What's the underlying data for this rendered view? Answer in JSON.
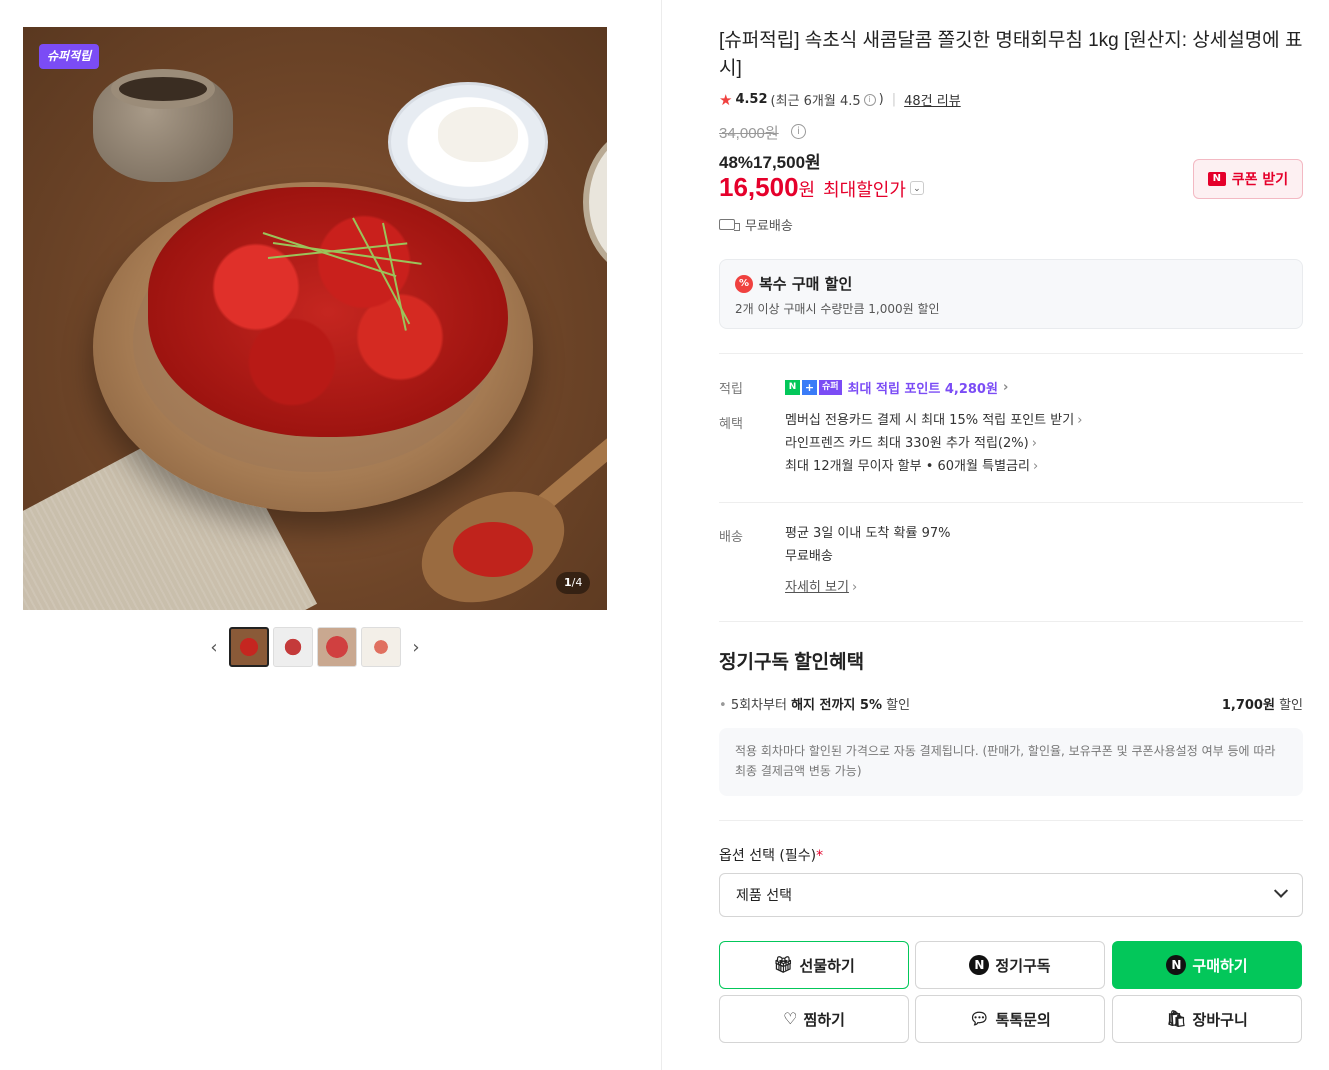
{
  "gallery": {
    "badge": "슈퍼적립",
    "counter_current": "1",
    "counter_total": "/4",
    "prev_icon": "chevron-left-icon",
    "next_icon": "chevron-right-icon"
  },
  "product": {
    "title": "[슈퍼적립] 속초식 새콤달콤 쫄깃한 명태회무침 1kg [원산지: 상세설명에 표시]",
    "rating": "4.52",
    "rating_recent": "(최근 6개월 4.5",
    "rating_recent_close": ")",
    "review_link": "48건 리뷰",
    "original_price": "34,000원",
    "discount_pct": "48%",
    "sale_price": "17,500원",
    "max_price": "16,500",
    "max_price_unit": "원",
    "max_price_label": "최대할인가",
    "coupon_button": "쿠폰 받기",
    "shipping": "무료배송"
  },
  "multi_discount": {
    "title": "복수 구매 할인",
    "desc": "2개 이상 구매시 수량만큼 1,000원 할인"
  },
  "benefits": {
    "points_label": "적립",
    "points_text": "최대 적립 포인트 4,280원",
    "benefit_label": "혜택",
    "items": [
      "멤버십 전용카드 결제 시 최대 15% 적립 포인트 받기",
      "라인프렌즈 카드 최대 330원 추가 적립(2%)",
      "최대 12개월 무이자 할부 • 60개월 특별금리"
    ],
    "delivery_label": "배송",
    "delivery_line1": "평균 3일 이내 도착 확률 97%",
    "delivery_line2": "무료배송",
    "detail_link": "자세히 보기"
  },
  "subscription": {
    "title": "정기구독 할인혜택",
    "line_prefix": "5회차부터 ",
    "line_bold": "해지 전까지 5%",
    "line_suffix": " 할인",
    "amount_bold": "1,700원",
    "amount_suffix": " 할인",
    "note": "적용 회차마다 할인된 가격으로 자동 결제됩니다. (판매가, 할인율, 보유쿠폰 및 쿠폰사용설정 여부 등에 따라 최종 결제금액 변동 가능)"
  },
  "options": {
    "label": "옵션 선택 (필수)",
    "required_mark": "*",
    "select_value": "제품 선택"
  },
  "buttons": {
    "gift": "선물하기",
    "subscribe": "정기구독",
    "buy": "구매하기",
    "wish": "찜하기",
    "talk": "톡톡문의",
    "cart": "장바구니"
  },
  "colors": {
    "naver_green": "#03c75a",
    "price_red": "#e5002b",
    "super_purple": "#7b4cf5"
  }
}
